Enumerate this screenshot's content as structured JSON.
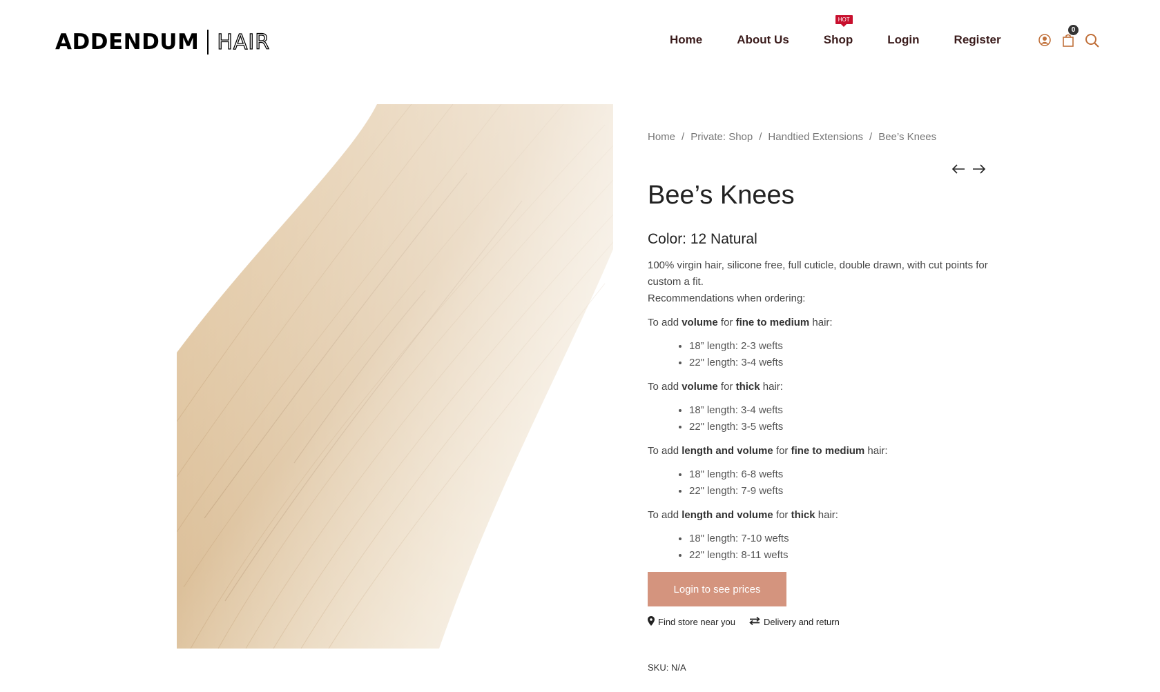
{
  "header": {
    "logo_main": "ADDENDUM",
    "logo_sub": "HAIR",
    "nav": [
      {
        "label": "Home"
      },
      {
        "label": "About Us"
      },
      {
        "label": "Shop",
        "badge": "HOT"
      },
      {
        "label": "Login"
      },
      {
        "label": "Register"
      }
    ],
    "cart_count": "0",
    "icons": [
      "user-icon",
      "cart-icon",
      "search-icon"
    ]
  },
  "breadcrumb": [
    "Home",
    "Private: Shop",
    "Handtied Extensions",
    "Bee’s Knees"
  ],
  "product": {
    "title": "Bee’s Knees",
    "color": "Color: 12 Natural",
    "description": "100% virgin hair, silicone free, full cuticle, double drawn, with cut points for custom a fit.",
    "recommend_intro": "Recommendations when ordering:",
    "groups": [
      {
        "prefix": "To add ",
        "what": "volume",
        "mid": " for ",
        "type": "fine to medium",
        "suffix": " hair:",
        "items": [
          "18” length:  2-3 wefts",
          "22\" length: 3-4 wefts"
        ]
      },
      {
        "prefix": "To add ",
        "what": "volume",
        "mid": " for ",
        "type": "thick",
        "suffix": " hair:",
        "items": [
          "18” length: 3-4 wefts",
          "22\" length: 3-5 wefts"
        ]
      },
      {
        "prefix": "To add ",
        "what": "length and volume",
        "mid": " for ",
        "type": "fine to medium",
        "suffix": " hair:",
        "items": [
          "18\" length: 6-8 wefts",
          "22\" length: 7-9 wefts"
        ]
      },
      {
        "prefix": "To add ",
        "what": "length and volume",
        "mid": " for ",
        "type": "thick",
        "suffix": " hair:",
        "items": [
          "18\" length: 7-10 wefts",
          "22\" length: 8-11 wefts"
        ]
      }
    ],
    "login_button": "Login to see prices",
    "find_store": "Find store near you",
    "delivery": "Delivery and return",
    "sku": "SKU: N/A"
  },
  "colors": {
    "nav_text": "#3a1b1b",
    "accent": "#d4947e",
    "hot": "#c8102e",
    "icon": "#c0703a"
  }
}
